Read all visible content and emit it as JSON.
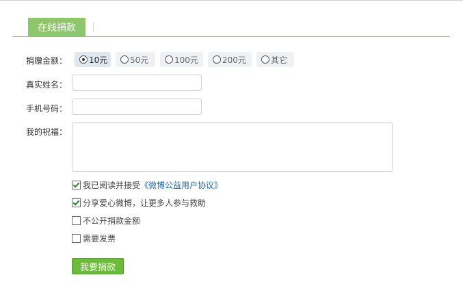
{
  "tab": {
    "label": "在线捐款"
  },
  "form": {
    "amount_label": "捐赠金额：",
    "amounts": [
      {
        "label": "10元",
        "selected": true
      },
      {
        "label": "50元",
        "selected": false
      },
      {
        "label": "100元",
        "selected": false
      },
      {
        "label": "200元",
        "selected": false
      },
      {
        "label": "其它",
        "selected": false
      }
    ],
    "name_label": "真实姓名：",
    "name_value": "",
    "phone_label": "手机号码：",
    "phone_value": "",
    "wish_label": "我的祝福：",
    "wish_value": "",
    "agreement_text": "我已阅读并接受",
    "agreement_link": "《微博公益用户协议》",
    "share_text": "分享爱心微博，让更多人参与救助",
    "anonymous_text": "不公开捐款金额",
    "invoice_text": "需要发票",
    "submit_label": "我要捐款"
  },
  "checkbox_states": {
    "agreement": true,
    "share": true,
    "anonymous": false,
    "invoice": false
  },
  "colors": {
    "accent": "#8ec66d",
    "button": "#6dbb3e",
    "link": "#1a6ab0"
  }
}
